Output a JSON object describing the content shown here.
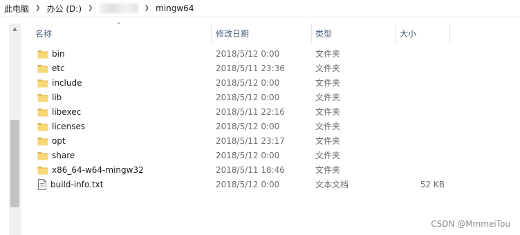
{
  "breadcrumb": {
    "items": [
      "此电脑",
      "办公 (D:)",
      "mingw64"
    ],
    "separator_icon": "chevron-right-icon"
  },
  "columns": {
    "name": "名称",
    "date": "修改日期",
    "type": "类型",
    "size": "大小",
    "sort_icon": "sort-ascending-icon"
  },
  "files": [
    {
      "name": "bin",
      "date": "2018/5/12 0:00",
      "type": "文件夹",
      "size": "",
      "icon": "folder-icon"
    },
    {
      "name": "etc",
      "date": "2018/5/11 23:36",
      "type": "文件夹",
      "size": "",
      "icon": "folder-icon"
    },
    {
      "name": "include",
      "date": "2018/5/12 0:00",
      "type": "文件夹",
      "size": "",
      "icon": "folder-icon"
    },
    {
      "name": "lib",
      "date": "2018/5/12 0:00",
      "type": "文件夹",
      "size": "",
      "icon": "folder-icon"
    },
    {
      "name": "libexec",
      "date": "2018/5/11 22:16",
      "type": "文件夹",
      "size": "",
      "icon": "folder-icon"
    },
    {
      "name": "licenses",
      "date": "2018/5/12 0:00",
      "type": "文件夹",
      "size": "",
      "icon": "folder-icon"
    },
    {
      "name": "opt",
      "date": "2018/5/11 23:17",
      "type": "文件夹",
      "size": "",
      "icon": "folder-icon"
    },
    {
      "name": "share",
      "date": "2018/5/12 0:00",
      "type": "文件夹",
      "size": "",
      "icon": "folder-icon"
    },
    {
      "name": "x86_64-w64-mingw32",
      "date": "2018/5/11 18:46",
      "type": "文件夹",
      "size": "",
      "icon": "folder-icon"
    },
    {
      "name": "build-info.txt",
      "date": "2018/5/12 0:00",
      "type": "文本文档",
      "size": "52 KB",
      "icon": "text-file-icon"
    }
  ],
  "watermark": "CSDN @MmmeiTou",
  "colors": {
    "folder": "#f8d775",
    "folder_dark": "#e0b44a",
    "header_text": "#4c607a",
    "secondary_text": "#6d6d6d"
  }
}
